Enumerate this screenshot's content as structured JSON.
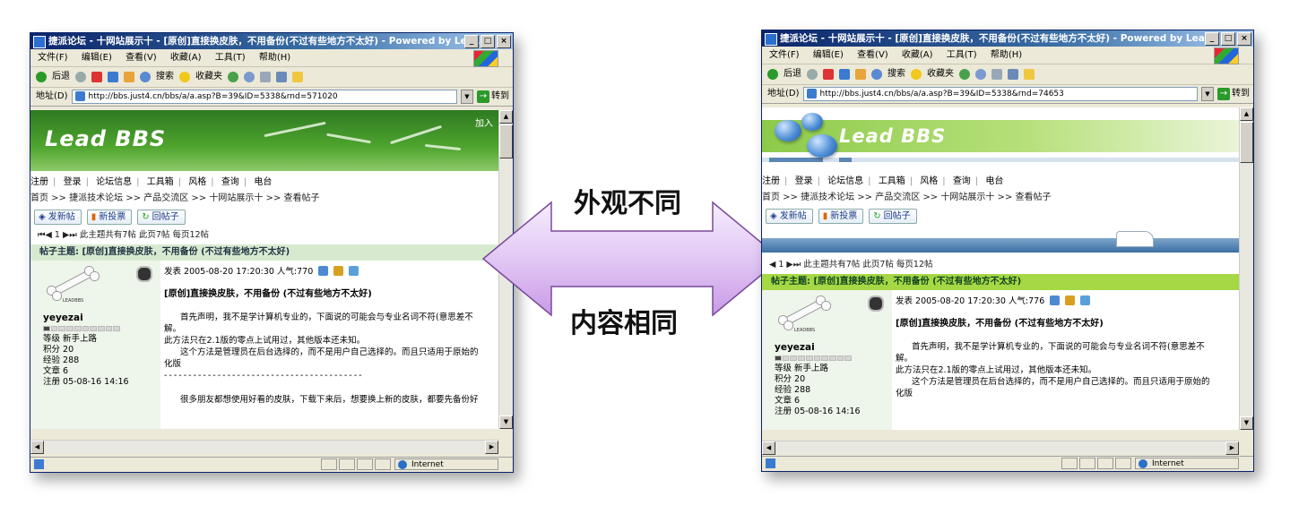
{
  "labels": {
    "top": "外观不同",
    "bottom": "内容相同"
  },
  "left": {
    "title": "捷派论坛 - 十网站展示十 - [原创]直接换皮肤，不用备份(不过有些地方不太好) - Powered by Lea...",
    "menu": [
      "文件(F)",
      "编辑(E)",
      "查看(V)",
      "收藏(A)",
      "工具(T)",
      "帮助(H)"
    ],
    "toolbar": {
      "back": "后退",
      "search": "搜索",
      "favorites": "收藏夹"
    },
    "address_label": "地址(D)",
    "url": "http://bbs.just4.cn/bbs/a/a.asp?B=39&ID=5338&rnd=571020",
    "go": "转到",
    "logo": "Lead BBS",
    "join": "加入",
    "nav": [
      "注册",
      "登录",
      "论坛信息",
      "工具箱",
      "风格",
      "查询",
      "电台"
    ],
    "breadcrumb": "首页 >> 捷派技术论坛 >> 产品交流区 >> 十网站展示十 >> 查看帖子",
    "buttons": [
      "发新帖",
      "新投票",
      "回帖子"
    ],
    "pager": "⏮◀ 1 ▶⏭ 此主题共有7帖 此页7帖 每页12帖",
    "topic": "帖子主题: [原创]直接换皮肤，不用备份 (不过有些地方不太好)",
    "avatar_tag": "LEADBBS",
    "username": "yeyezai",
    "stats": [
      "等级 新手上路",
      "积分 20",
      "经验 288",
      "文章 6",
      "注册 05-08-16 14:16"
    ],
    "post_meta": "发表 2005-08-20 17:20:30 人气:770",
    "post_title": "[原创]直接换皮肤，不用备份 (不过有些地方不太好)",
    "body": [
      "首先声明，我不是学计算机专业的，下面说的可能会与专业名词不符(意思差不",
      "解。",
      "此方法只在2.1版的零点上试用过，其他版本还未知。",
      "这个方法是管理员在后台选择的，而不是用户自己选择的。而且只适用于原始的",
      "化版",
      "-----------------------------------------",
      "很多朋友都想使用好看的皮肤，下载下来后，想要换上新的皮肤，都要先备份好"
    ],
    "status": "Internet"
  },
  "right": {
    "title": "捷派论坛 - 十网站展示十 - [原创]直接换皮肤，不用备份(不过有些地方不太好) - Powered by Lea...",
    "menu": [
      "文件(F)",
      "编辑(E)",
      "查看(V)",
      "收藏(A)",
      "工具(T)",
      "帮助(H)"
    ],
    "toolbar": {
      "back": "后退",
      "search": "搜索",
      "favorites": "收藏夹"
    },
    "address_label": "地址(D)",
    "url": "http://bbs.just4.cn/bbs/a/a.asp?B=39&ID=5338&rnd=74653",
    "go": "转到",
    "logo": "Lead BBS",
    "nav": [
      "注册",
      "登录",
      "论坛信息",
      "工具箱",
      "风格",
      "查询",
      "电台"
    ],
    "breadcrumb": "首页 >> 捷派技术论坛 >> 产品交流区 >> 十网站展示十 >> 查看帖子",
    "buttons": [
      "发新帖",
      "新投票",
      "回帖子"
    ],
    "pager": "◀ 1 ▶⏭ 此主题共有7帖 此页7帖 每页12帖",
    "topic": "帖子主题: [原创]直接换皮肤，不用备份 (不过有些地方不太好)",
    "avatar_tag": "LEADBBS",
    "username": "yeyezai",
    "stats": [
      "等级 新手上路",
      "积分 20",
      "经验 288",
      "文章 6",
      "注册 05-08-16 14:16"
    ],
    "post_meta": "发表 2005-08-20 17:20:30 人气:776",
    "post_title": "[原创]直接换皮肤，不用备份 (不过有些地方不太好)",
    "body": [
      "首先声明，我不是学计算机专业的，下面说的可能会与专业名词不符(意思差不",
      "解。",
      "此方法只在2.1版的零点上试用过，其他版本还未知。",
      "这个方法是管理员在后台选择的，而不是用户自己选择的。而且只适用于原始的",
      "化版"
    ],
    "status": "Internet"
  }
}
